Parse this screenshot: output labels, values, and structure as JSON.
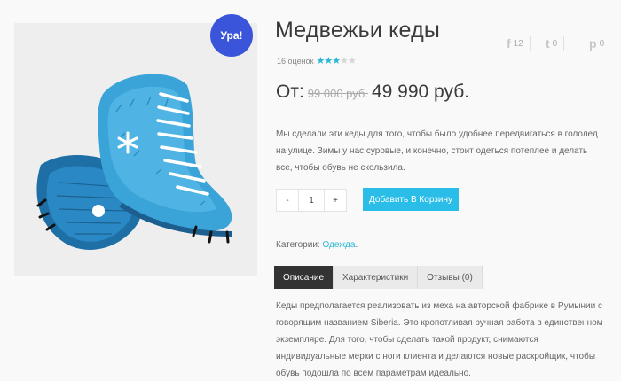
{
  "badge": "Ура!",
  "product": {
    "title": "Медвежьи кеды",
    "rating_count": "16 оценок",
    "rating_value": 3,
    "rating_max": 5
  },
  "social": [
    {
      "icon": "facebook-icon",
      "glyph": "f",
      "count": "12"
    },
    {
      "icon": "twitter-icon",
      "glyph": "t",
      "count": "0"
    },
    {
      "icon": "pinterest-icon",
      "glyph": "p",
      "count": "0"
    }
  ],
  "price": {
    "prefix": "От:",
    "old": "99 000 руб.",
    "current": "49 990 руб."
  },
  "description": "Мы сделали эти кеды для того, чтобы было удобнее передвигаться в гололед на улице. Зимы у нас суровые, и конечно, стоит одеться потеплее и делать все, чтобы обувь не скользила.",
  "quantity": {
    "minus": "-",
    "value": "1",
    "plus": "+"
  },
  "add_to_cart": "Добавить В Корзину",
  "categories": {
    "label": "Категории:",
    "link": "Одежда",
    "suffix": "."
  },
  "tabs": [
    {
      "label": "Описание",
      "active": true
    },
    {
      "label": "Характеристики",
      "active": false
    },
    {
      "label": "Отзывы (0)",
      "active": false
    }
  ],
  "tab_content": "Кеды предполагается реализовать из меха на авторской фабрике в Румынии с говорящим названием Siberia. Это кропотливая ручная работа в единственном экземпляре. Для того, чтобы сделать такой продукт, снимаются индивидуальные мерки с ноги клиента и делаются новые раскройщик, чтобы обувь подошла по всем параметрам идеально.",
  "colors": {
    "accent": "#2bb7d6",
    "button": "#29bde8",
    "badge": "#3a55d9",
    "tab_active": "#333333"
  }
}
